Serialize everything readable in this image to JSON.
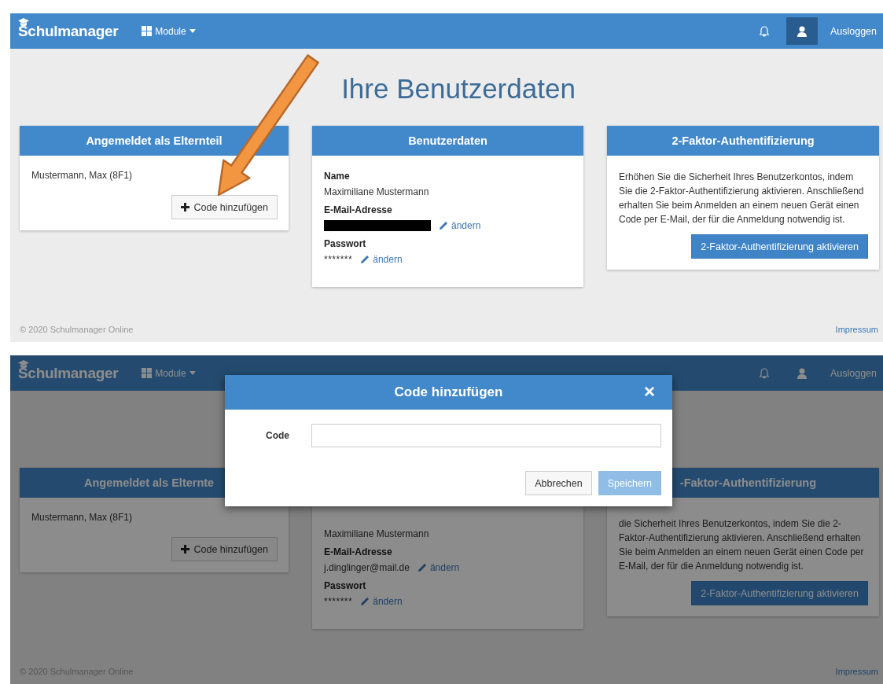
{
  "panels": [
    {
      "dimmed": false,
      "arrow_annotation": true,
      "navbar": {
        "brand": "Schulmanager",
        "menu": "Module",
        "logout": "Ausloggen",
        "user_active": true
      },
      "page_title": "Ihre Benutzerdaten",
      "cards": [
        {
          "kind": "account",
          "title": "Angemeldet als Elternteil",
          "child": "Mustermann, Max (8F1)",
          "button": "Code hinzufügen"
        },
        {
          "kind": "userdata",
          "title": "Benutzerdaten",
          "fields": [
            {
              "kind": "name",
              "label": "Name",
              "value": "Maximiliane Mustermann"
            },
            {
              "kind": "email",
              "label": "E-Mail-Adresse",
              "redacted": true,
              "action": "ändern"
            },
            {
              "kind": "password",
              "label": "Passwort",
              "value": "*******",
              "action": "ändern"
            }
          ]
        },
        {
          "kind": "twofactor",
          "title": "2-Faktor-Authentifizierung",
          "text": "Erhöhen Sie die Sicherheit Ihres Benutzerkontos, indem Sie die 2-Faktor-Authentifizierung aktivieren. Anschließend erhalten Sie beim Anmelden an einem neuen Gerät einen Code per E-Mail, der für die Anmeldung notwendig ist.",
          "button": "2-Faktor-Authentifizierung aktivieren"
        }
      ],
      "footer": {
        "copyright": "© 2020 Schulmanager Online",
        "link": "Impressum"
      }
    },
    {
      "dimmed": true,
      "arrow_annotation": false,
      "navbar": {
        "brand": "Schulmanager",
        "menu": "Module",
        "logout": "Ausloggen",
        "user_active": false
      },
      "cards": [
        {
          "kind": "account",
          "title": "Angemeldet als Elternte",
          "child": "Mustermann, Max (8F1)",
          "button": "Code hinzufügen"
        },
        {
          "kind": "userdata",
          "fields": [
            {
              "kind": "name",
              "value": "Maximiliane Mustermann"
            },
            {
              "kind": "email",
              "label": "E-Mail-Adresse",
              "value": "j.dinglinger@mail.de",
              "redacted": false,
              "action": "ändern"
            },
            {
              "kind": "password",
              "label": "Passwort",
              "value": "*******",
              "action": "ändern"
            }
          ]
        },
        {
          "kind": "twofactor",
          "title": "-Faktor-Authentifizierung",
          "text": "die Sicherheit Ihres Benutzerkontos, indem Sie die 2-Faktor-Authentifizierung aktivieren. Anschließend erhalten Sie beim Anmelden an einem neuen Gerät einen Code per E-Mail, der für die Anmeldung notwendig ist.",
          "button": "2-Faktor-Authentifizierung aktivieren"
        }
      ],
      "footer": {
        "copyright": "© 2020 Schulmanager Online",
        "link": "Impressum"
      },
      "modal": {
        "title": "Code hinzufügen",
        "close": "×",
        "field_label": "Code",
        "buttons": [
          {
            "label": "Abbrechen",
            "kind": "default",
            "disabled": false
          },
          {
            "label": "Speichern",
            "kind": "primary",
            "disabled": true
          }
        ]
      }
    }
  ]
}
